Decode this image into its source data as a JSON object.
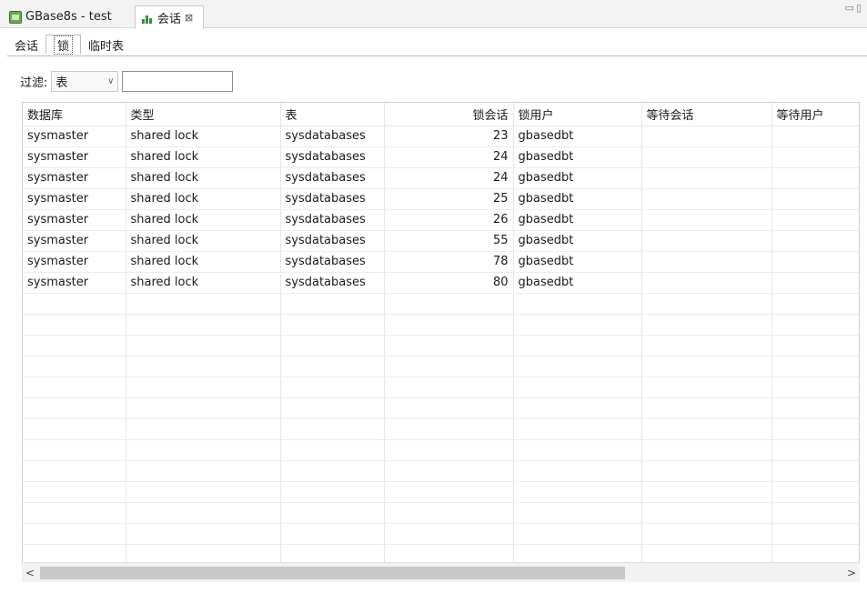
{
  "editor_tabs": [
    {
      "label": "GBase8s - test",
      "icon": "database-icon",
      "active": false
    },
    {
      "label": "会话",
      "icon": "chart-icon",
      "active": true
    }
  ],
  "sub_tabs": [
    "会话",
    "锁",
    "临时表"
  ],
  "selected_sub_tab": 1,
  "filter": {
    "label": "过滤:",
    "select_value": "表",
    "input_value": ""
  },
  "table": {
    "columns": [
      "数据库",
      "类型",
      "表",
      "锁会话",
      "锁用户",
      "等待会话",
      "等待用户"
    ],
    "rows": [
      [
        "sysmaster",
        "shared lock",
        "sysdatabases",
        "23",
        "gbasedbt",
        "",
        ""
      ],
      [
        "sysmaster",
        "shared lock",
        "sysdatabases",
        "24",
        "gbasedbt",
        "",
        ""
      ],
      [
        "sysmaster",
        "shared lock",
        "sysdatabases",
        "24",
        "gbasedbt",
        "",
        ""
      ],
      [
        "sysmaster",
        "shared lock",
        "sysdatabases",
        "25",
        "gbasedbt",
        "",
        ""
      ],
      [
        "sysmaster",
        "shared lock",
        "sysdatabases",
        "26",
        "gbasedbt",
        "",
        ""
      ],
      [
        "sysmaster",
        "shared lock",
        "sysdatabases",
        "55",
        "gbasedbt",
        "",
        ""
      ],
      [
        "sysmaster",
        "shared lock",
        "sysdatabases",
        "78",
        "gbasedbt",
        "",
        ""
      ],
      [
        "sysmaster",
        "shared lock",
        "sysdatabases",
        "80",
        "gbasedbt",
        "",
        ""
      ]
    ],
    "empty_rows": 13
  },
  "scrollbar": {
    "left_arrow": "<",
    "right_arrow": ">",
    "thumb_fraction": 0.73
  },
  "colors": {
    "accent_green": "#3c8c3c"
  }
}
